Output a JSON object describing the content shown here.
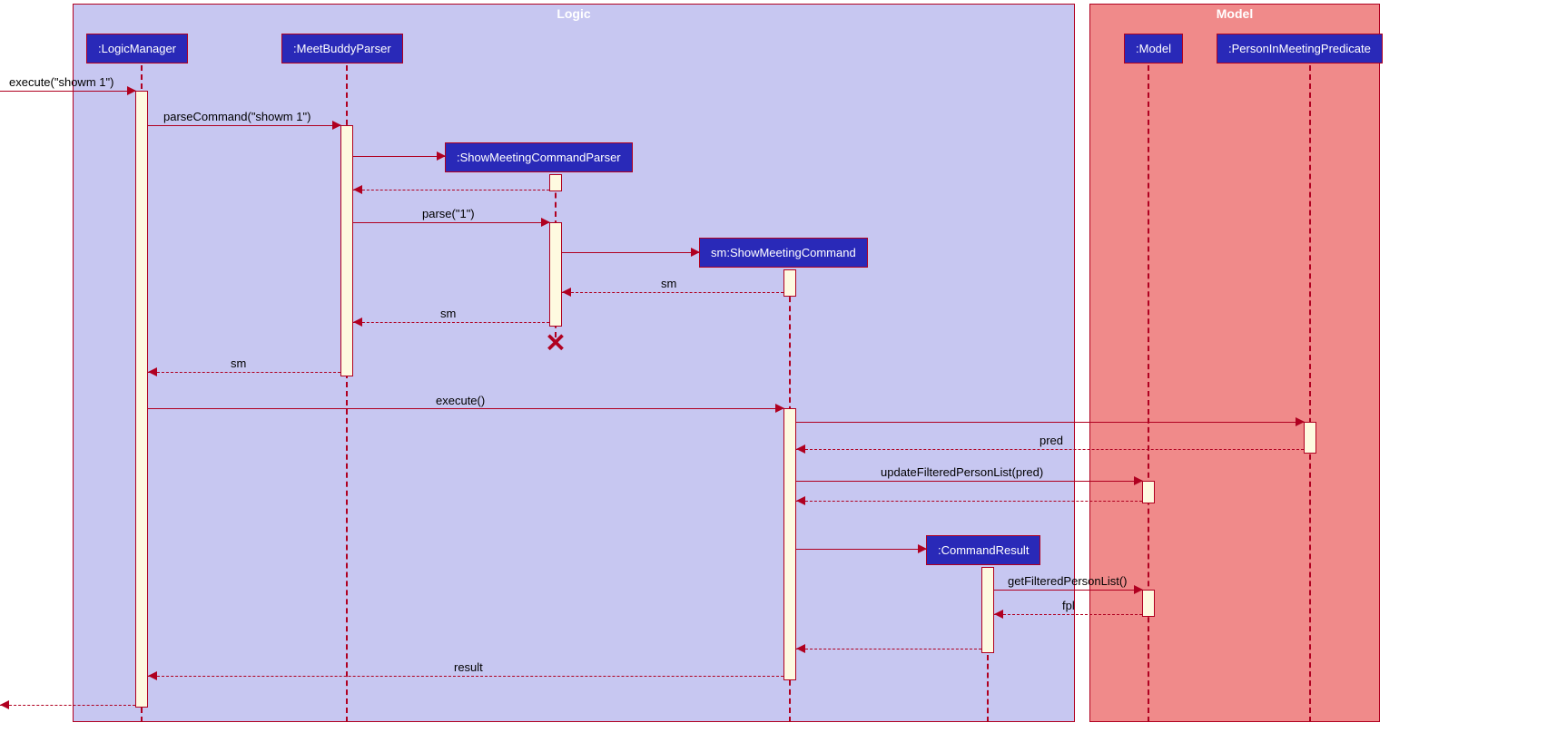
{
  "containers": {
    "logic": "Logic",
    "model": "Model"
  },
  "objects": {
    "logicManager": ":LogicManager",
    "meetBuddyParser": ":MeetBuddyParser",
    "showMeetingCommandParser": ":ShowMeetingCommandParser",
    "showMeetingCommand": "sm:ShowMeetingCommand",
    "commandResult": ":CommandResult",
    "model": ":Model",
    "personInMeetingPredicate": ":PersonInMeetingPredicate"
  },
  "messages": {
    "execute1": "execute(\"showm 1\")",
    "parseCommand": "parseCommand(\"showm 1\")",
    "parse": "parse(\"1\")",
    "sm1": "sm",
    "sm2": "sm",
    "sm3": "sm",
    "execute2": "execute()",
    "pred": "pred",
    "updateFilteredPersonList": "updateFilteredPersonList(pred)",
    "getFilteredPersonList": "getFilteredPersonList()",
    "fpl": "fpl",
    "result": "result"
  }
}
